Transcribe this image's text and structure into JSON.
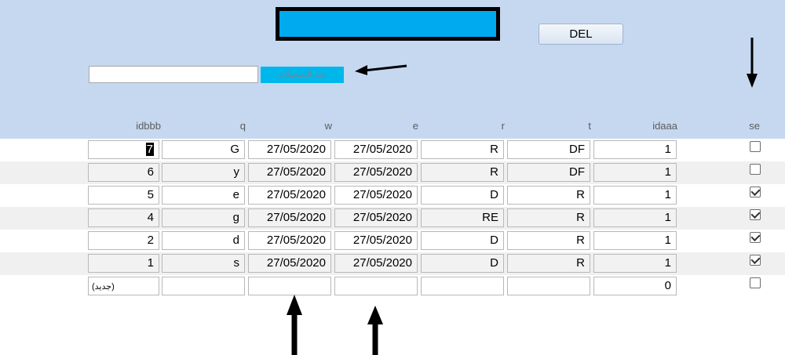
{
  "toolbar": {
    "del_label": "DEL",
    "count_button_label": "عدد التسجيلات",
    "count_input_value": ""
  },
  "table": {
    "headers": [
      "idbbb",
      "q",
      "w",
      "e",
      "r",
      "t",
      "idaaa",
      "se"
    ],
    "rows": [
      {
        "idbbb": "7",
        "q": "G",
        "w": "27/05/2020",
        "e": "27/05/2020",
        "r": "R",
        "t": "DF",
        "idaaa": "1",
        "se": false
      },
      {
        "idbbb": "6",
        "q": "y",
        "w": "27/05/2020",
        "e": "27/05/2020",
        "r": "R",
        "t": "DF",
        "idaaa": "1",
        "se": false
      },
      {
        "idbbb": "5",
        "q": "e",
        "w": "27/05/2020",
        "e": "27/05/2020",
        "r": "D",
        "t": "R",
        "idaaa": "1",
        "se": true
      },
      {
        "idbbb": "4",
        "q": "g",
        "w": "27/05/2020",
        "e": "27/05/2020",
        "r": "RE",
        "t": "R",
        "idaaa": "1",
        "se": true
      },
      {
        "idbbb": "2",
        "q": "d",
        "w": "27/05/2020",
        "e": "27/05/2020",
        "r": "D",
        "t": "R",
        "idaaa": "1",
        "se": true
      },
      {
        "idbbb": "1",
        "q": "s",
        "w": "27/05/2020",
        "e": "27/05/2020",
        "r": "D",
        "t": "R",
        "idaaa": "1",
        "se": true
      }
    ],
    "new_row": {
      "idbbb_placeholder": "(جديد)",
      "idaaa": "0",
      "se": false
    }
  },
  "colors": {
    "header_bg": "#c5d8f0",
    "title_fill": "#00aaee",
    "count_button_bg": "#00b7eb",
    "alt_row_bg": "#f0f0f0"
  },
  "icons": [
    "arrow-left-icon",
    "arrow-down-icon",
    "arrow-up-icon"
  ]
}
